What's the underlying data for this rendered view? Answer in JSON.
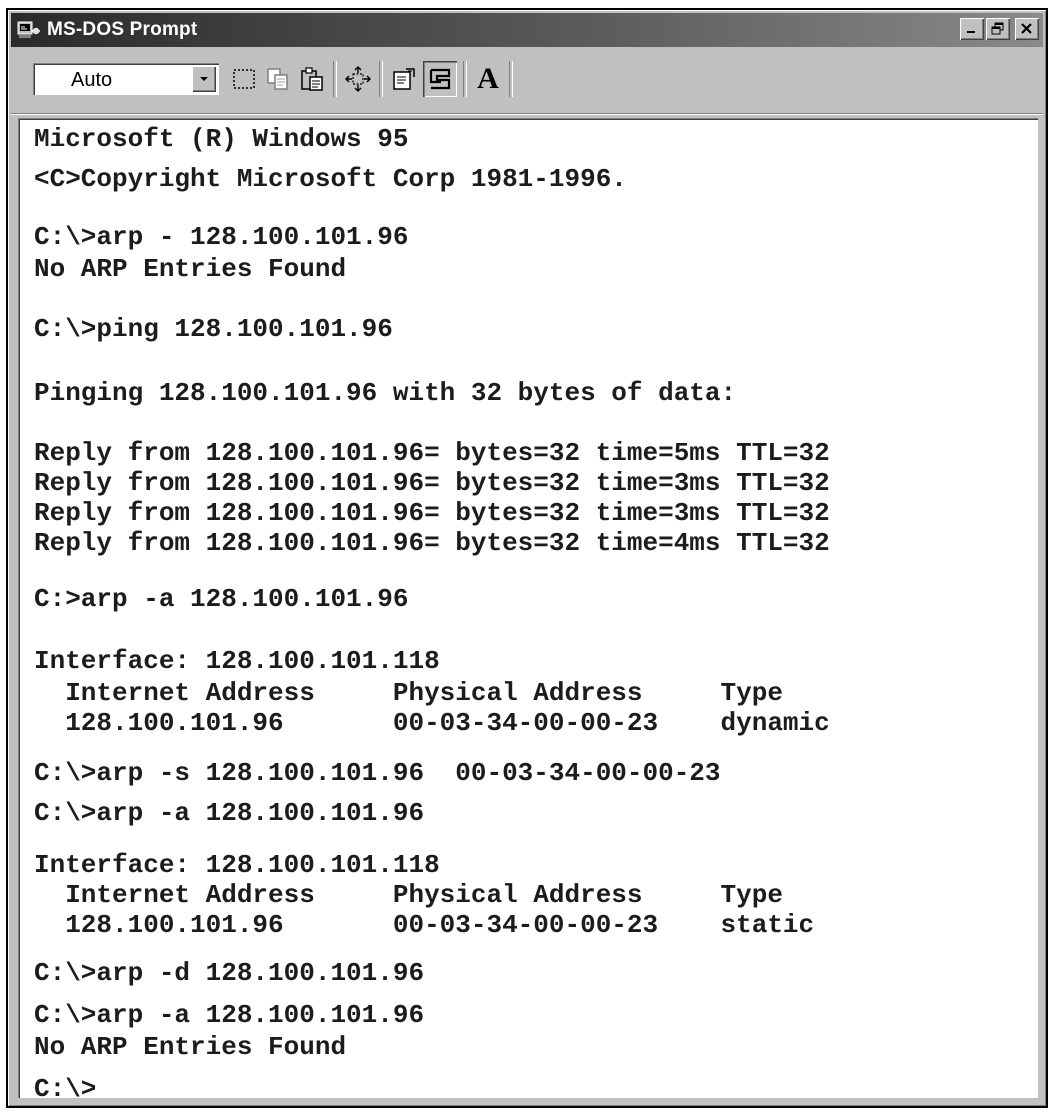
{
  "window": {
    "title": "MS-DOS Prompt"
  },
  "toolbar": {
    "font_size_value": "Auto",
    "buttons": [
      "mark-icon",
      "copy-icon",
      "paste-icon",
      "full-screen-icon",
      "properties-icon",
      "background-icon",
      "font-icon"
    ],
    "font_button_glyph": "A"
  },
  "console": {
    "lines": [
      "Microsoft (R) Windows 95",
      "<C>Copyright Microsoft Corp 1981-1996.",
      "C:\\>arp - 128.100.101.96",
      "No ARP Entries Found",
      "C:\\>ping 128.100.101.96",
      "Pinging 128.100.101.96 with 32 bytes of data:",
      "Reply from 128.100.101.96= bytes=32 time=5ms TTL=32",
      "Reply from 128.100.101.96= bytes=32 time=3ms TTL=32",
      "Reply from 128.100.101.96= bytes=32 time=3ms TTL=32",
      "Reply from 128.100.101.96= bytes=32 time=4ms TTL=32",
      "C:>arp -a 128.100.101.96",
      "Interface: 128.100.101.118",
      "  Internet Address     Physical Address     Type",
      "  128.100.101.96       00-03-34-00-00-23    dynamic",
      "C:\\>arp -s 128.100.101.96  00-03-34-00-00-23",
      "C:\\>arp -a 128.100.101.96",
      "Interface: 128.100.101.118",
      "  Internet Address     Physical Address     Type",
      "  128.100.101.96       00-03-34-00-00-23    static",
      "C:\\>arp -d 128.100.101.96",
      "C:\\>arp -a 128.100.101.96",
      "No ARP Entries Found",
      "C:\\>"
    ]
  }
}
